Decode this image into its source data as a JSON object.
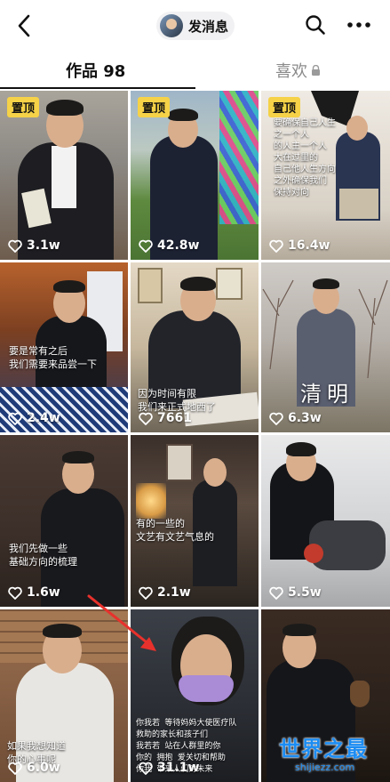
{
  "header": {
    "message_label": "发消息"
  },
  "tabs": {
    "works_label": "作品 98",
    "likes_label": "喜欢"
  },
  "pin_label": "置顶",
  "videos": [
    {
      "likes": "3.1w",
      "pinned": true
    },
    {
      "likes": "42.8w",
      "pinned": true
    },
    {
      "likes": "16.4w",
      "pinned": true,
      "caption": "要确保自己人生\n之一个人\n的人主一个人\n大在过里的\n自己他人生方向\n之外确保我们\n保持对向"
    },
    {
      "likes": "2.4w",
      "caption": "要是常有之后\n我们需要来品尝一下"
    },
    {
      "likes": "7661",
      "caption": "因为时间有限\n我们来正式地西了"
    },
    {
      "likes": "6.3w",
      "caption_big": "清明"
    },
    {
      "likes": "1.6w",
      "caption": "我们先做一些\n基础方向的梳理"
    },
    {
      "likes": "2.1w",
      "caption": "有的一些的\n文艺有文艺气息的"
    },
    {
      "likes": "5.5w"
    },
    {
      "likes": "6.0w",
      "caption": "如果我想知道\n你的心事呢"
    },
    {
      "likes": "31.1w",
      "caption": "你我若 等待妈妈大使医疗队\n救助的家长和孩子们\n我若若 站在人群里的你\n你的 拥抱 爱关切和帮助\n你我 带来人们对未来"
    },
    {
      "likes": ""
    }
  ],
  "watermark": {
    "title": "世界之最",
    "url": "shijiezz.com"
  },
  "colors": {
    "pin_badge": "#f5d247",
    "annotation_arrow": "#e8312c",
    "watermark": "#1c8cf2"
  }
}
